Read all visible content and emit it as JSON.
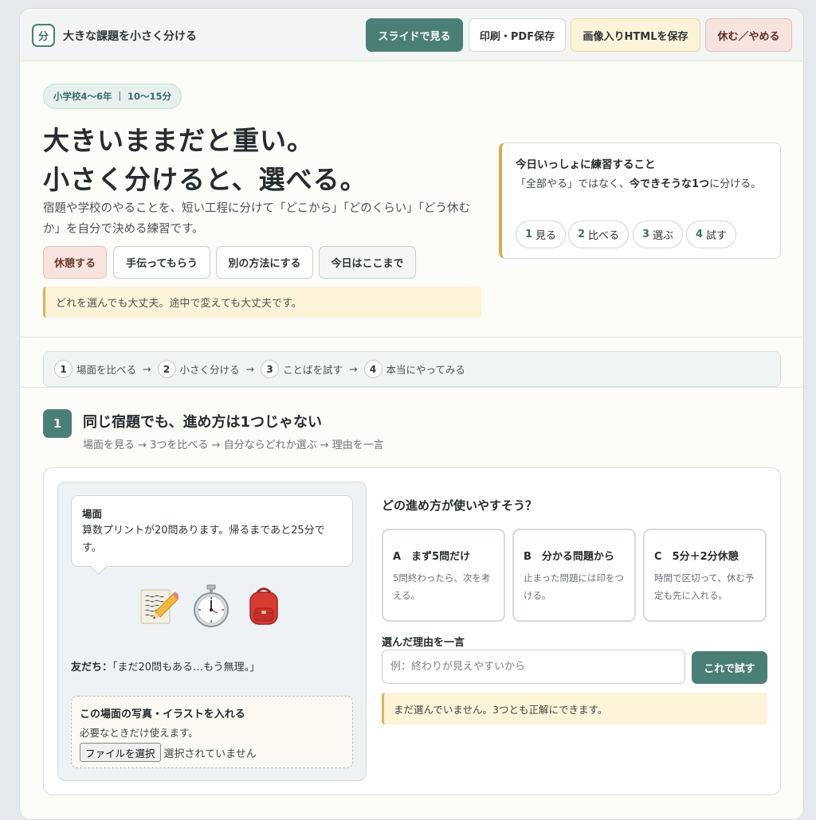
{
  "header": {
    "logo_glyph": "分",
    "app_title": "大きな課題を小さく分ける",
    "buttons": {
      "slide": "スライドで見る",
      "print": "印刷・PDF保存",
      "save_html": "画像入りHTMLを保存",
      "stop": "休む／やめる"
    }
  },
  "hero": {
    "pill": "小学校4〜6年 ｜ 10〜15分",
    "headline_line1": "大きいままだと重い。",
    "headline_line2": "小さく分けると、選べる。",
    "lead": "宿題や学校のやることを、短い工程に分けて「どこから」「どのくらい」「どう休むか」を自分で決める練習です。",
    "options": {
      "rest": "休憩する",
      "help": "手伝ってもらう",
      "other": "別の方法にする",
      "end": "今日はここまで"
    },
    "note": "どれを選んでも大丈夫。途中で変えても大丈夫です。"
  },
  "practice": {
    "title": "今日いっしょに練習すること",
    "text_before": "「全部やる」ではなく、",
    "text_bold": "今できそうな1つ",
    "text_after": "に分ける。",
    "steps": [
      {
        "num": "1",
        "label": "見る"
      },
      {
        "num": "2",
        "label": "比べる"
      },
      {
        "num": "3",
        "label": "選ぶ"
      },
      {
        "num": "4",
        "label": "試す"
      }
    ]
  },
  "progress": {
    "steps": [
      {
        "num": "1",
        "label": "場面を比べる"
      },
      {
        "num": "2",
        "label": "小さく分ける"
      },
      {
        "num": "3",
        "label": "ことばを試す"
      },
      {
        "num": "4",
        "label": "本当にやってみる"
      }
    ],
    "arrow": "→"
  },
  "section1": {
    "num": "1",
    "title": "同じ宿題でも、進め方は1つじゃない",
    "subtitle": "場面を見る → 3つを比べる → 自分ならどれか選ぶ → 理由を一言"
  },
  "scene": {
    "label": "場面",
    "text": "算数プリントが20問あります。帰るまであと25分です。",
    "icons": [
      "memo-pencil-icon",
      "stopwatch-icon",
      "backpack-icon"
    ],
    "friend_label": "友だち：",
    "friend_text": "「まだ20問もある…もう無理。」",
    "upload_title": "この場面の写真・イラストを入れる",
    "upload_help": "必要なときだけ使えます。",
    "file_button": "ファイルを選択",
    "file_status": "選択されていません"
  },
  "question": {
    "title": "どの進め方が使いやすそう？",
    "choices": [
      {
        "title": "A　まず5問だけ",
        "desc": "5問終わったら、次を考える。"
      },
      {
        "title": "B　分かる問題から",
        "desc": "止まった問題には印をつける。"
      },
      {
        "title": "C　5分＋2分休憩",
        "desc": "時間で区切って、休む予定も先に入れる。"
      }
    ],
    "reason_label": "選んだ理由を一言",
    "reason_placeholder": "例：終わりが見えやすいから",
    "reason_value": "",
    "try_button": "これで試す",
    "status": "まだ選んでいません。3つとも正解にできます。"
  },
  "colors": {
    "accent": "#4a7f77",
    "note_bg": "#fdf3d8",
    "note_border": "#d8b45d",
    "rest_bg": "#f8e4de"
  }
}
